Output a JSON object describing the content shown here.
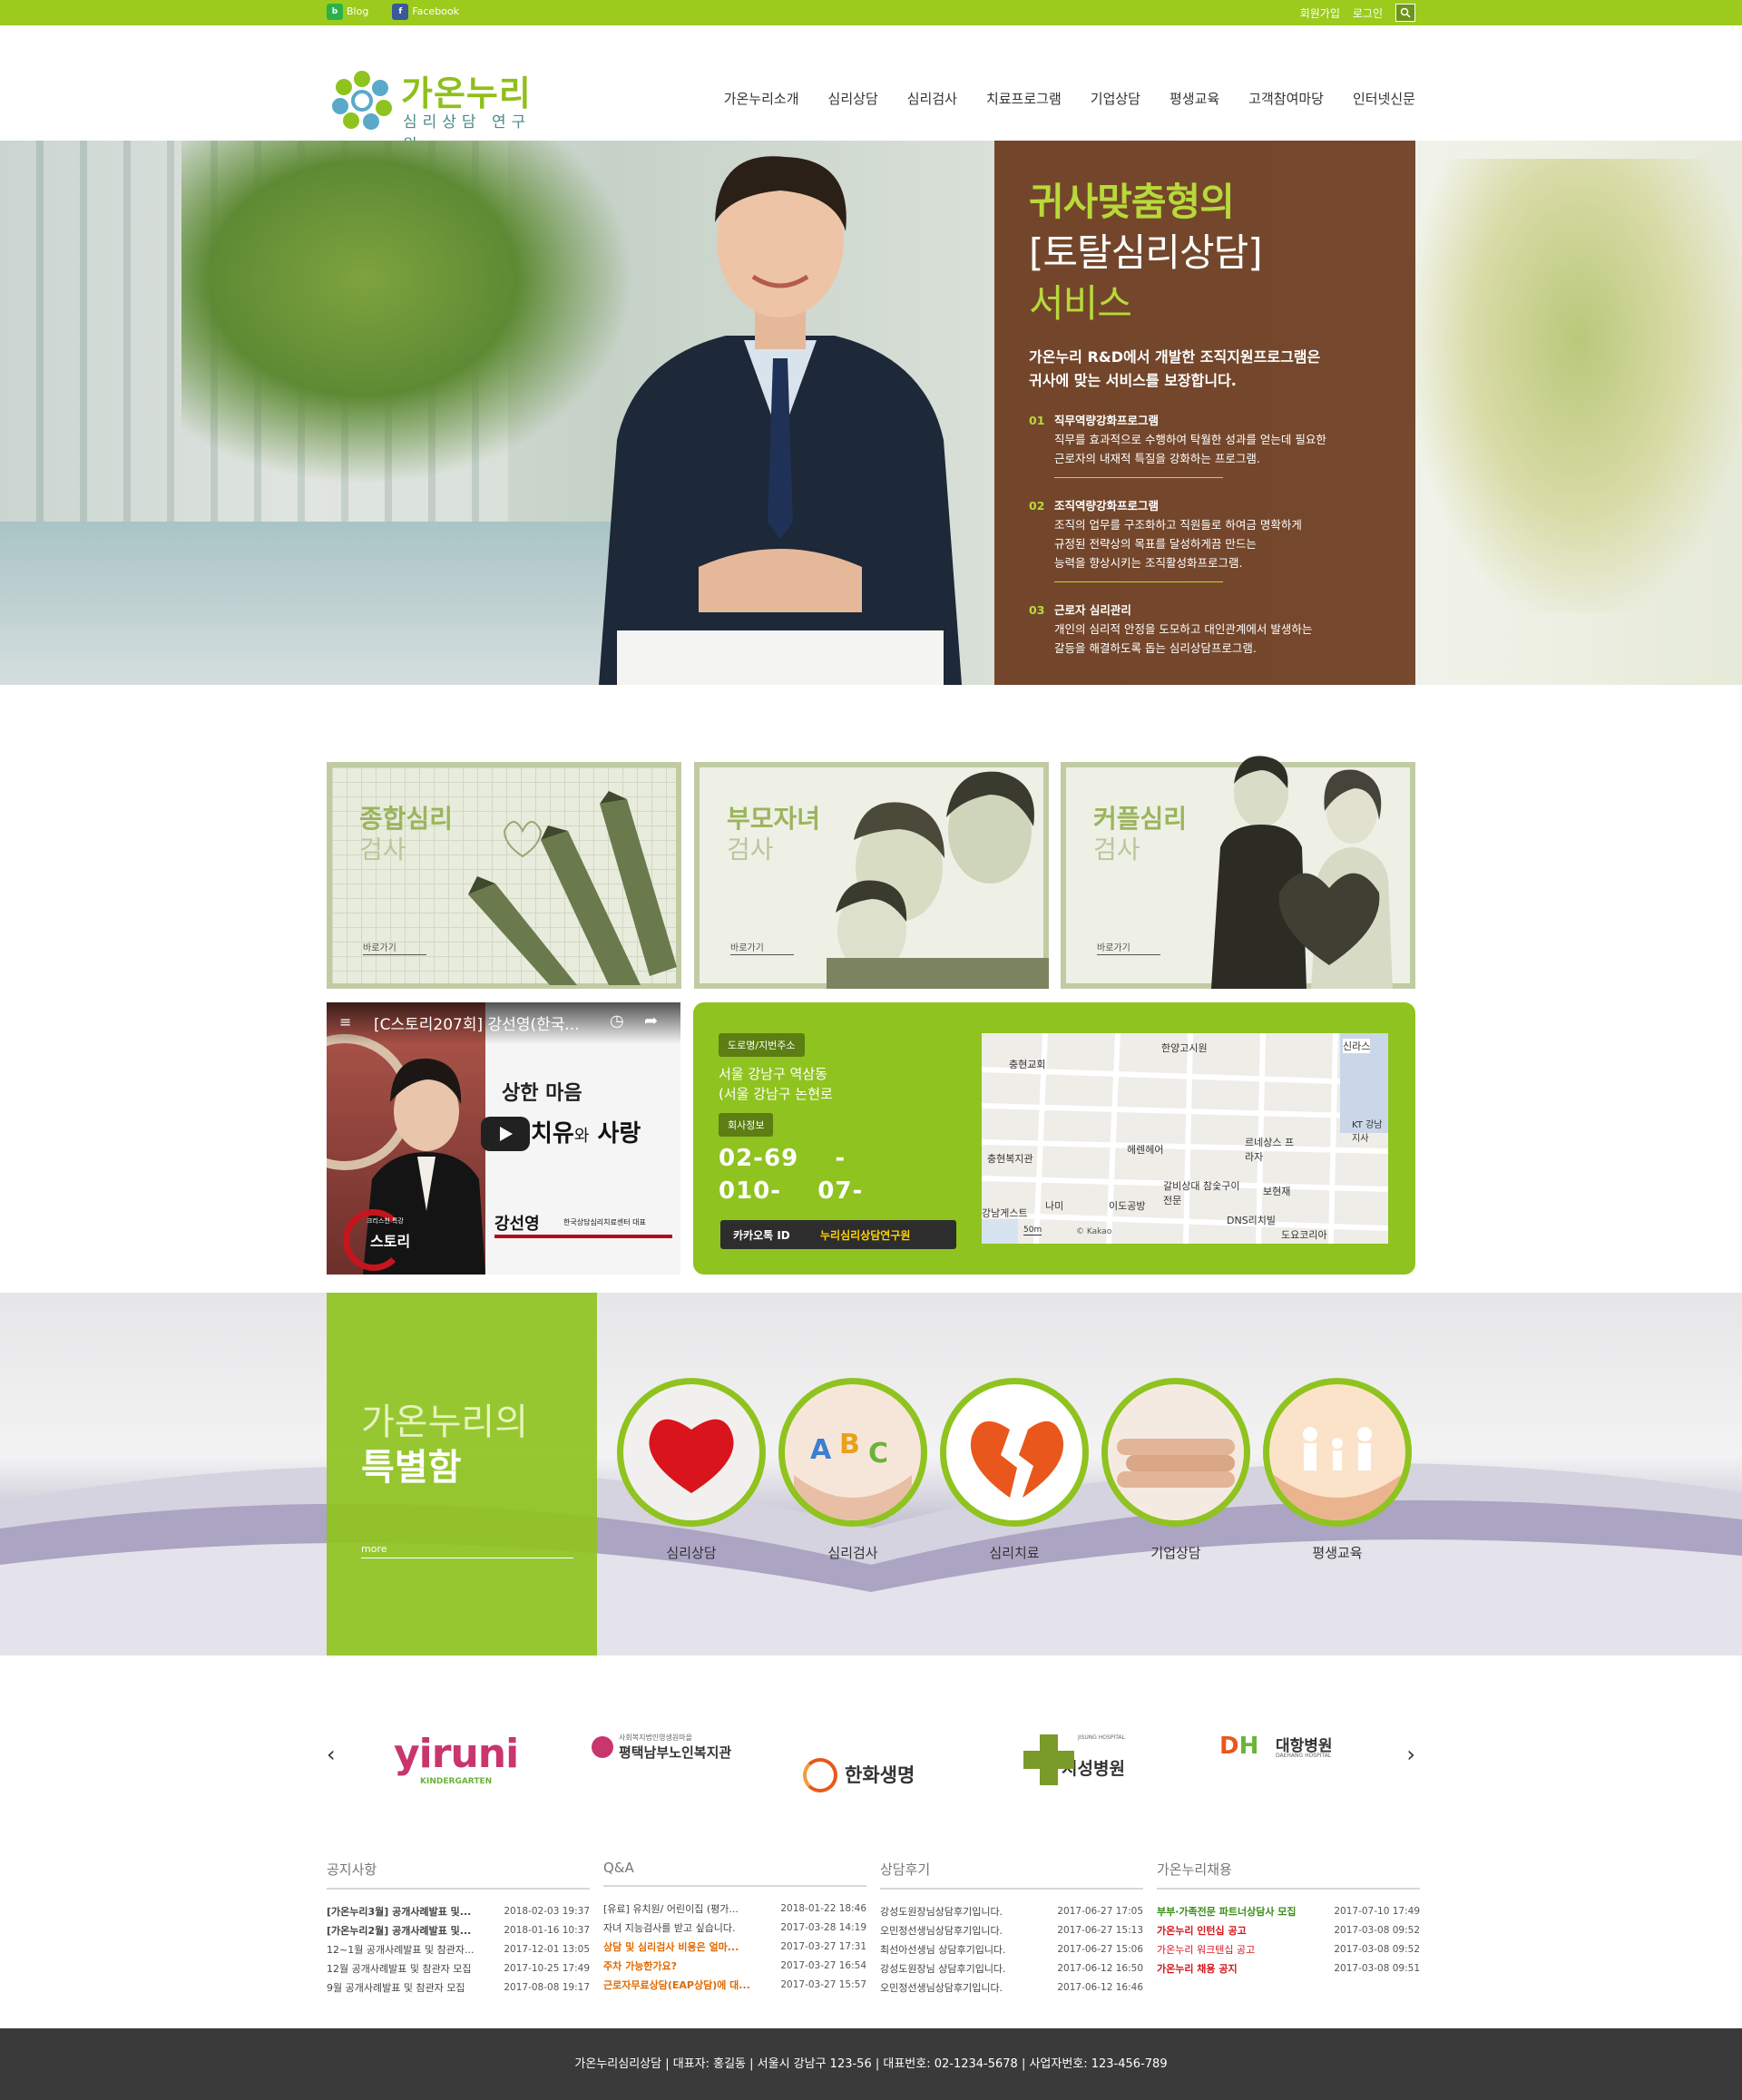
{
  "topbar": {
    "blog": "Blog",
    "facebook": "Facebook",
    "join": "회원가입",
    "login": "로그인"
  },
  "logo": {
    "name": "가온누리",
    "sub": "심리상담 연구원"
  },
  "nav": [
    "가온누리소개",
    "심리상담",
    "심리검사",
    "치료프로그램",
    "기업상담",
    "평생교육",
    "고객참여마당",
    "인터넷신문"
  ],
  "hero": {
    "line1": "귀사맞춤형의",
    "line2": "[토탈심리상담]",
    "line3": "서비스",
    "intro1": "가온누리 R&D에서 개발한 조직지원프로그램은",
    "intro2": "귀사에 맞는 서비스를 보장합니다.",
    "items": [
      {
        "no": "01",
        "title": "직무역량강화프로그램",
        "d1": "직무를 효과적으로 수행하여 탁월한 성과를 얻는데 필요한",
        "d2": "근로자의 내재적 특질을 강화하는 프로그램.",
        "d3": ""
      },
      {
        "no": "02",
        "title": "조직역량강화프로그램",
        "d1": "조직의 업무를 구조화하고 직원들로 하여금 명확하게",
        "d2": "규정된 전략상의 목표를 달성하게끔 만드는",
        "d3": "능력을 향상시키는 조직활성화프로그램."
      },
      {
        "no": "03",
        "title": "근로자 심리관리",
        "d1": "개인의 심리적 안정을 도모하고 대인관계에서 발생하는",
        "d2": "갈등을 해결하도록 돕는 심리상담프로그램.",
        "d3": ""
      }
    ]
  },
  "cards": [
    {
      "t1": "종합심리",
      "t2": "검사",
      "go": "바로가기"
    },
    {
      "t1": "부모자녀",
      "t2": "검사",
      "go": "바로가기"
    },
    {
      "t1": "커플심리",
      "t2": "검사",
      "go": "바로가기"
    }
  ],
  "video": {
    "title": "[C스토리207회] 강선영(한국...",
    "cap1": "상한 마음",
    "cap2a": "치유",
    "cap2b": "와",
    "cap2c": "사랑",
    "name": "강선영",
    "org": "한국상담심리치료센터 대표",
    "logo1": "크리스천 특강",
    "logo2": "스토리"
  },
  "contact": {
    "addr_tag": "도로명/지번주소",
    "addr1": "서울 강남구 역삼동",
    "addr2": "(서울 강남구 논현로",
    "info_tag": "회사정보",
    "tel1": "02-69    -",
    "tel2": "010-    07-",
    "kakao_label": "카카오톡 ID",
    "kakao_id": "누리심리상담연구원"
  },
  "map": {
    "labels": [
      "충현교회",
      "한양고시원",
      "신라스",
      "KT 강남지사",
      "충현복지관",
      "헤렌헤어",
      "르네상스 프라자",
      "갈비상대 참숯구이전문",
      "나미",
      "이도공방",
      "보현재",
      "강남게스트",
      "DNS리치빌",
      "도요코리아"
    ],
    "scale": "50m",
    "credit": "© Kakao"
  },
  "special": {
    "t1": "가온누리의",
    "t2": "특별함",
    "more": "more",
    "items": [
      "심리상담",
      "심리검사",
      "심리치료",
      "기업상담",
      "평생교육"
    ]
  },
  "partners": [
    {
      "name": "yiruni",
      "sub": "KINDERGARTEN"
    },
    {
      "name": "평택남부노인복지관",
      "sub": "사회복지법인영생원마을"
    },
    {
      "name": "한화생명",
      "sub": ""
    },
    {
      "name": "지성병원",
      "sub": "JISUNG HOSPITAL"
    },
    {
      "name": "대항병원",
      "sub": "DAEHANG HOSPITAL"
    }
  ],
  "boards": [
    {
      "title": "공지사항",
      "rows": [
        {
          "t": "[가온누리3월] 공개사례발표 및...",
          "d": "2018-02-03",
          "h": "19:37"
        },
        {
          "t": "[가온누리2월] 공개사례발표 및...",
          "d": "2018-01-16",
          "h": "10:37"
        },
        {
          "t": "12~1월 공개사례발표 및 참관자...",
          "d": "2017-12-01",
          "h": "13:05"
        },
        {
          "t": "12월 공개사례발표 및 참관자 모집",
          "d": "2017-10-25",
          "h": "17:49"
        },
        {
          "t": "9월 공개사례발표 및 참관자 모집",
          "d": "2017-08-08",
          "h": "19:17"
        }
      ]
    },
    {
      "title": "Q&A",
      "rows": [
        {
          "t": "[유료] 유치원/ 어린이집 (평가...",
          "d": "2018-01-22",
          "h": "18:46"
        },
        {
          "t": "자녀 지능검사를 받고 싶습니다.",
          "d": "2017-03-28",
          "h": "14:19"
        },
        {
          "t": "상담 및 심리검사 비용은 얼마...",
          "d": "2017-03-27",
          "h": "17:31"
        },
        {
          "t": "주차 가능한가요?",
          "d": "2017-03-27",
          "h": "16:54"
        },
        {
          "t": "근로자무료상담(EAP상담)에 대...",
          "d": "2017-03-27",
          "h": "15:57"
        }
      ]
    },
    {
      "title": "상담후기",
      "rows": [
        {
          "t": "강성도원장님상담후기입니다.",
          "d": "2017-06-27",
          "h": "17:05"
        },
        {
          "t": "오민정선생님상담후기입니다.",
          "d": "2017-06-27",
          "h": "15:13"
        },
        {
          "t": "최선아선생님 상담후기입니다.",
          "d": "2017-06-27",
          "h": "15:06"
        },
        {
          "t": "강성도원장님 상담후기입니다.",
          "d": "2017-06-12",
          "h": "16:50"
        },
        {
          "t": "오민정선생님상담후기입니다.",
          "d": "2017-06-12",
          "h": "16:46"
        }
      ]
    },
    {
      "title": "가온누리채용",
      "rows": [
        {
          "t": "부부·가족전문 파트너상담사 모집",
          "d": "2017-07-10",
          "h": "17:49"
        },
        {
          "t": "가온누리 인턴십 공고",
          "d": "2017-03-08",
          "h": "09:52"
        },
        {
          "t": "가온누리 워크텐십 공고",
          "d": "2017-03-08",
          "h": "09:52"
        },
        {
          "t": "가온누리 채용 공지",
          "d": "2017-03-08",
          "h": "09:51"
        }
      ]
    }
  ],
  "footer": "가온누리심리상담 | 대표자: 홍길동 | 서울시 강남구 123-56 | 대표번호: 02-1234-5678 | 사업자번호: 123-456-789",
  "colors": {
    "accent": "#8fc31f",
    "panel": "#64301 2",
    "footer": "#3a3a3a"
  }
}
